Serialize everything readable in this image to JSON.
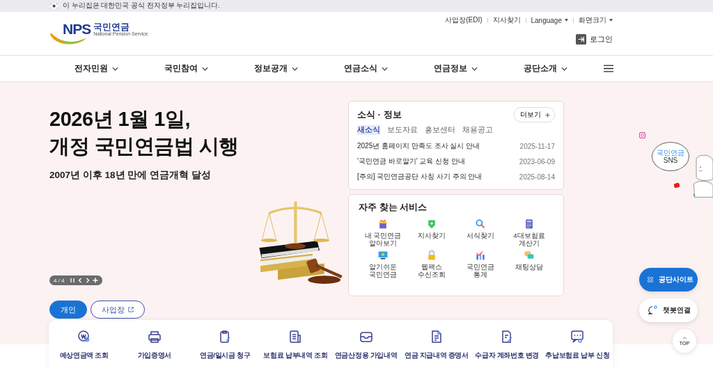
{
  "gov_banner": {
    "text": "이 누리집은 대한민국 공식 전자정부 누리집입니다."
  },
  "header": {
    "logo": {
      "abbr": "NPS",
      "name": "국민연금",
      "subtitle": "National Pension Service"
    },
    "utility_links": [
      {
        "label": "사업장(EDI)",
        "has_dropdown": false
      },
      {
        "label": "지사찾기",
        "has_dropdown": false
      },
      {
        "label": "Language",
        "has_dropdown": true
      },
      {
        "label": "화면크기",
        "has_dropdown": true
      }
    ],
    "login": "로그인"
  },
  "nav": [
    {
      "label": "전자민원"
    },
    {
      "label": "국민참여"
    },
    {
      "label": "정보공개"
    },
    {
      "label": "연금소식"
    },
    {
      "label": "연금정보"
    },
    {
      "label": "공단소개"
    }
  ],
  "hero": {
    "title_lines": [
      "2026년 1월 1일,",
      "개정 국민연금법 시행"
    ],
    "subtitle": "2007년 이후 18년 만에 연금개혁 달성",
    "counter": "4 / 4",
    "user_tabs": [
      {
        "label": "개인",
        "selected": true,
        "external": false
      },
      {
        "label": "사업장",
        "selected": false,
        "external": true
      }
    ]
  },
  "news": {
    "title": "소식 · 정보",
    "more": "더보기",
    "tabs": [
      {
        "label": "새소식",
        "selected": true
      },
      {
        "label": "보도자료",
        "selected": false
      },
      {
        "label": "홍보센터",
        "selected": false
      },
      {
        "label": "채용공고",
        "selected": false
      }
    ],
    "items": [
      {
        "title": "2025년 홈페이지 만족도 조사 실시 안내",
        "date": "2025-11-17"
      },
      {
        "title": "'국민연금 바로알기' 교육 신청 안내",
        "date": "2023-06-09"
      },
      {
        "title": "[주의] 국민연금공단 사칭 사기 주의 안내",
        "date": "2025-08-14"
      }
    ]
  },
  "services": {
    "title": "자주 찾는 서비스",
    "items": [
      {
        "label": "내 국민연금\n알아보기",
        "kind": "gift"
      },
      {
        "label": "지사찾기",
        "kind": "pin"
      },
      {
        "label": "서식찾기",
        "kind": "search"
      },
      {
        "label": "4대보험료\n계산기",
        "kind": "calculator"
      },
      {
        "label": "알기쉬운\n국민연금",
        "kind": "monitor"
      },
      {
        "label": "웹팩스\n수신조회",
        "kind": "lock"
      },
      {
        "label": "국민연금\n통계",
        "kind": "chart"
      },
      {
        "label": "채팅상담",
        "kind": "chat"
      }
    ]
  },
  "sns": {
    "small": "국민연금",
    "label": "SNS"
  },
  "floating": [
    {
      "label": "공단사이트",
      "kind": "primary"
    },
    {
      "label": "챗봇연결",
      "kind": "secondary"
    }
  ],
  "top": "TOP",
  "quick_menu": [
    {
      "label": "예상연금액 조회",
      "kind": "coin-search"
    },
    {
      "label": "가입증명서",
      "kind": "printer"
    },
    {
      "label": "연금/일시금 청구",
      "kind": "clipboard"
    },
    {
      "label": "보험료 납부내역 조회",
      "kind": "document"
    },
    {
      "label": "연금산정용 가입내역",
      "kind": "inbox"
    },
    {
      "label": "연금 지급내역 증명서",
      "kind": "certificate"
    },
    {
      "label": "수급자 계좌번호 변경",
      "kind": "edit-doc"
    },
    {
      "label": "추납보험료 납부 신청",
      "kind": "chat-search"
    }
  ]
}
